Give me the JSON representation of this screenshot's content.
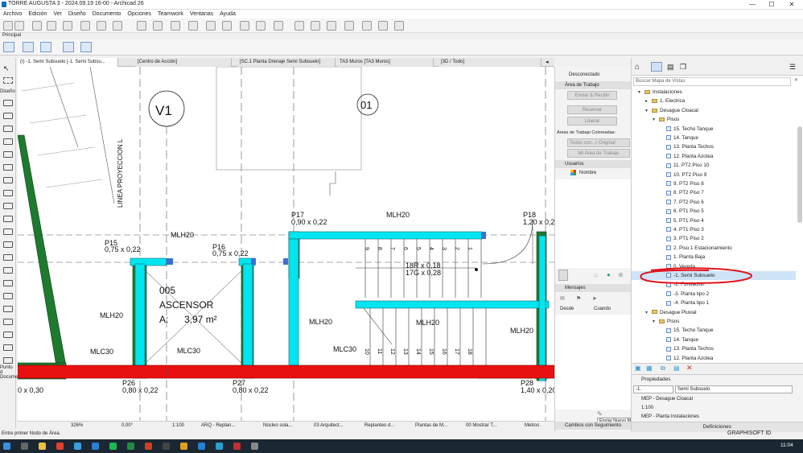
{
  "window": {
    "title": "TORRE AUGUSTA 3 - 2024.09.19 16-00 - Archicad 26",
    "controls": [
      "—",
      "☐",
      "✕"
    ]
  },
  "menu": [
    "Archivo",
    "Edición",
    "Ver",
    "Diseño",
    "Documento",
    "Opciones",
    "Teamwork",
    "Ventanas",
    "Ayuda"
  ],
  "toolbar_label": "Principal",
  "toolbox": {
    "section_label": "Diseño",
    "bottom_labels": [
      "Punto d",
      "Docume"
    ]
  },
  "tabs": [
    {
      "label": "(I) -1. Semi Subsuelo [-1. Semi Subsu...",
      "active": true
    },
    {
      "label": "[Centro de Acción]",
      "active": false
    },
    {
      "label": "[SC.1 Planta Drenaje Semi Subsuelo]",
      "active": false
    },
    {
      "label": "TA3 Muros [TA3 Muros]",
      "active": false
    },
    {
      "label": "[3D / Todo]",
      "active": false
    }
  ],
  "drawing": {
    "axis_v1": "V1",
    "axis_01": "01",
    "vertical_label": "LINEA PROYECCION L",
    "columns": [
      {
        "name": "P15",
        "size": "0,75 x 0,22"
      },
      {
        "name": "P16",
        "size": "0,75 x 0,22"
      },
      {
        "name": "P17",
        "size": "0,90 x 0,22"
      },
      {
        "name": "P18",
        "size": "1,20 x 0,2"
      },
      {
        "name": "P26",
        "size": "0,80 x 0,22"
      },
      {
        "name": "P27",
        "size": "0,80 x 0,22"
      },
      {
        "name": "P28",
        "size": "1,40 x 0,20"
      }
    ],
    "left_cut_size": "0 x 0,30",
    "beam_labels": [
      "MLH20",
      "MLH20",
      "MLH20",
      "MLH20",
      "MLH20",
      "MLH20"
    ],
    "mlc_labels": [
      "MLC30",
      "MLC30",
      "MLC30"
    ],
    "zone": {
      "number": "005",
      "name": "ASCENSOR",
      "area_label": "A:",
      "area_value": "3,97 m²"
    },
    "stair_upper": [
      "9",
      "8",
      "7",
      "6",
      "5",
      "4",
      "3",
      "2",
      "1"
    ],
    "stair_lower": [
      "10",
      "11",
      "12",
      "13",
      "14",
      "15",
      "16",
      "17",
      "18"
    ],
    "stair_info": [
      "18R x 0,18",
      "17G x 0,28"
    ]
  },
  "status": {
    "zoom": "326%",
    "angle": "0,00°",
    "scale": "1:100",
    "layer_combo": "ARQ - Replan...",
    "model_view": "Núcleo sola...",
    "pen_set": "03 Arquitect...",
    "override": "Replanteo d...",
    "renovation": "Plantas de M...",
    "filter": "00 Mostrar T...",
    "units": "Metros"
  },
  "hint": "Entre primer Nodo de Área.",
  "teamwork": {
    "status": "Desconectado",
    "workspace_header": "Área de Trabajo",
    "send_receive": "Enviar & Recibir",
    "reserve": "Reservar",
    "release": "Liberar",
    "colored_label": "Áreas de Trabajo Coloreadas:",
    "colored_value": "Todos con...r Original",
    "my_workspace": "Mi Área de Trabajo",
    "users_header": "Usuarios",
    "users_name": "Nombre",
    "messages_header": "Mensajes",
    "desde": "Desde",
    "cuando": "Cuando",
    "send_message_tooltip": "Enviar Nuevo Mensaje",
    "changes_header": "Cambios con Seguimiento"
  },
  "navigator": {
    "search_placeholder": "Buscar Mapa de Vistas",
    "tree": [
      {
        "label": "Instalaciones",
        "level": 0,
        "kind": "folder",
        "toggle": "v"
      },
      {
        "label": "1. Electrica",
        "level": 1,
        "kind": "folder",
        "toggle": ">"
      },
      {
        "label": "Desague Cloacal",
        "level": 1,
        "kind": "folder",
        "toggle": "v"
      },
      {
        "label": "Pisos",
        "level": 2,
        "kind": "folder",
        "toggle": "v"
      },
      {
        "label": "15. Techo Tanque",
        "level": 3,
        "kind": "view"
      },
      {
        "label": "14. Tanque",
        "level": 3,
        "kind": "view"
      },
      {
        "label": "13. Planta Techos",
        "level": 3,
        "kind": "view"
      },
      {
        "label": "12. Planta Azotea",
        "level": 3,
        "kind": "view"
      },
      {
        "label": "11. PT2 Piso 10",
        "level": 3,
        "kind": "view"
      },
      {
        "label": "10. PT2 Piso 9",
        "level": 3,
        "kind": "view"
      },
      {
        "label": "9. PT2 Piso 8",
        "level": 3,
        "kind": "view"
      },
      {
        "label": "8. PT2 Piso 7",
        "level": 3,
        "kind": "view"
      },
      {
        "label": "7. PT2 Piso 6",
        "level": 3,
        "kind": "view"
      },
      {
        "label": "6. PT1 Piso 5",
        "level": 3,
        "kind": "view"
      },
      {
        "label": "5. PT1 Piso 4",
        "level": 3,
        "kind": "view"
      },
      {
        "label": "4. PT1 Piso 3",
        "level": 3,
        "kind": "view"
      },
      {
        "label": "3. PT1 Piso 2",
        "level": 3,
        "kind": "view"
      },
      {
        "label": "2. Piso 1 Estacionamiento",
        "level": 3,
        "kind": "view"
      },
      {
        "label": "1. Planta Baja",
        "level": 3,
        "kind": "view"
      },
      {
        "label": "0. Vereda",
        "level": 3,
        "kind": "view"
      },
      {
        "label": "-1. Semi Subsuelo",
        "level": 3,
        "kind": "view",
        "selected": true
      },
      {
        "label": "-2. Fundación",
        "level": 3,
        "kind": "view"
      },
      {
        "label": "-3. Planta tipo 2",
        "level": 3,
        "kind": "view"
      },
      {
        "label": "-4. Planta tipo 1",
        "level": 3,
        "kind": "view"
      },
      {
        "label": "Desague Pluvial",
        "level": 1,
        "kind": "folder",
        "toggle": "v"
      },
      {
        "label": "Pisos",
        "level": 2,
        "kind": "folder",
        "toggle": "v"
      },
      {
        "label": "15. Techo Tanque",
        "level": 3,
        "kind": "view"
      },
      {
        "label": "14. Tanque",
        "level": 3,
        "kind": "view"
      },
      {
        "label": "13. Planta Techos",
        "level": 3,
        "kind": "view"
      },
      {
        "label": "12. Planta Azotea",
        "level": 3,
        "kind": "view"
      }
    ],
    "properties": {
      "header": "Propiedades",
      "id_value": "-1.",
      "name_value": "Semi Subsuelo",
      "layer_combo": "MEP - Desague Cloacal",
      "scale": "1:100",
      "model_view": "MEP - Planta Instalaciones",
      "definitions": "Definiciones"
    }
  },
  "taskbar": {
    "brand": "GRAPHISOFT ID",
    "time": "11:04"
  },
  "colors": {
    "wall_green": "#1e7a2e",
    "beam_cyan": "#00e5f0",
    "slab_red": "#e81010",
    "beam_blue": "#3d6fd6",
    "selection_annotation": "#e0141e"
  }
}
